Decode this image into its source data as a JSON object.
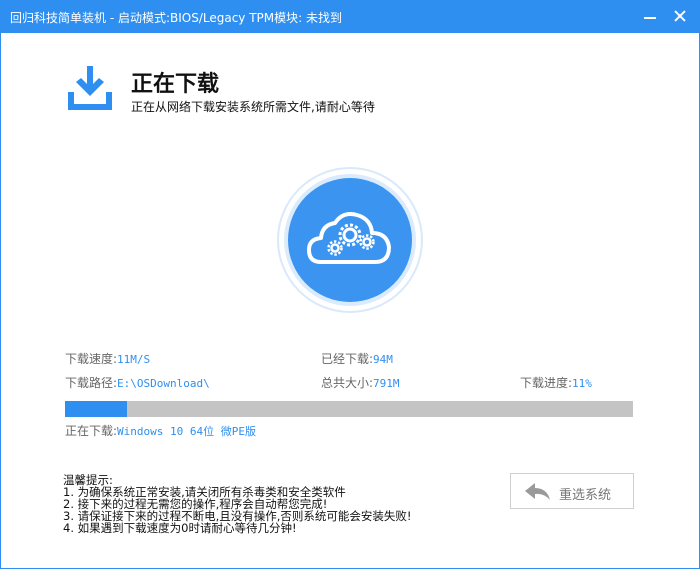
{
  "window": {
    "title": "回归科技简单装机 - 启动模式:BIOS/Legacy TPM模块: 未找到"
  },
  "header": {
    "title": "正在下载",
    "subtitle": "正在从网络下载安装系统所需文件,请耐心等待"
  },
  "stats": {
    "speed_label": "下载速度:",
    "speed_value": "11M/S",
    "downloaded_label": "已经下载:",
    "downloaded_value": "94M",
    "path_label": "下载路径:",
    "path_value": "E:\\OSDownload\\",
    "total_label": "总共大小:",
    "total_value": "791M",
    "progress_label": "下载进度:",
    "progress_value": "11%",
    "progress_fraction": 0.11
  },
  "current": {
    "label": "正在下载:",
    "value": "Windows 10 64位 微PE版"
  },
  "tips": {
    "title": "温馨提示:",
    "items": [
      "1. 为确保系统正常安装,请关闭所有杀毒类和安全类软件",
      "2. 接下来的过程无需您的操作,程序会自动帮您完成!",
      "3. 请保证接下来的过程不断电,且没有操作,否则系统可能会安装失败!",
      "4. 如果遇到下载速度为0时请耐心等待几分钟!"
    ]
  },
  "buttons": {
    "reselect_label": "重选系统"
  },
  "colors": {
    "accent": "#2f8ff0",
    "track": "#c4c4c4"
  }
}
